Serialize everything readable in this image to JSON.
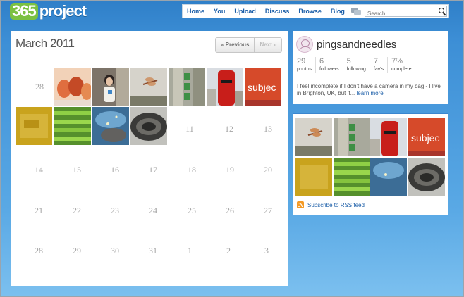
{
  "header": {
    "logo_number": "365",
    "logo_word": "project",
    "nav": [
      "Home",
      "You",
      "Upload",
      "Discuss",
      "Browse",
      "Blog"
    ],
    "search_placeholder": "Search"
  },
  "calendar": {
    "title": "March 2011",
    "prev_label": "« Previous",
    "next_label": "Next »",
    "row1": [
      "28"
    ],
    "row2": [
      "11",
      "12",
      "13"
    ],
    "row3": [
      "14",
      "15",
      "16",
      "17",
      "18",
      "19",
      "20"
    ],
    "row4": [
      "21",
      "22",
      "23",
      "24",
      "25",
      "26",
      "27"
    ],
    "row5": [
      "28",
      "29",
      "30",
      "31",
      "1",
      "2",
      "3"
    ],
    "photos": [
      "red jelly sweets",
      "girl holding a mug",
      "dragonfly on a twig",
      "green bottles on a wall",
      "red postbox",
      "orange sign reading subject",
      "golden yellow texture",
      "green asparagus",
      "blue sky with sparkles",
      "tyre tread"
    ]
  },
  "profile": {
    "username": "pingsandneedles",
    "stats": [
      {
        "num": "29",
        "label": "photos"
      },
      {
        "num": "6",
        "label": "followers"
      },
      {
        "num": "5",
        "label": "following"
      },
      {
        "num": "7",
        "label": "fav's"
      },
      {
        "num": "7%",
        "label": "complete"
      }
    ],
    "bio": "I feel incomplete if I don't have a camera in my bag - I live in Brighton, UK, but if...",
    "more_label": "learn more"
  },
  "recent": {
    "rss_label": "Subscribe to RSS feed"
  }
}
